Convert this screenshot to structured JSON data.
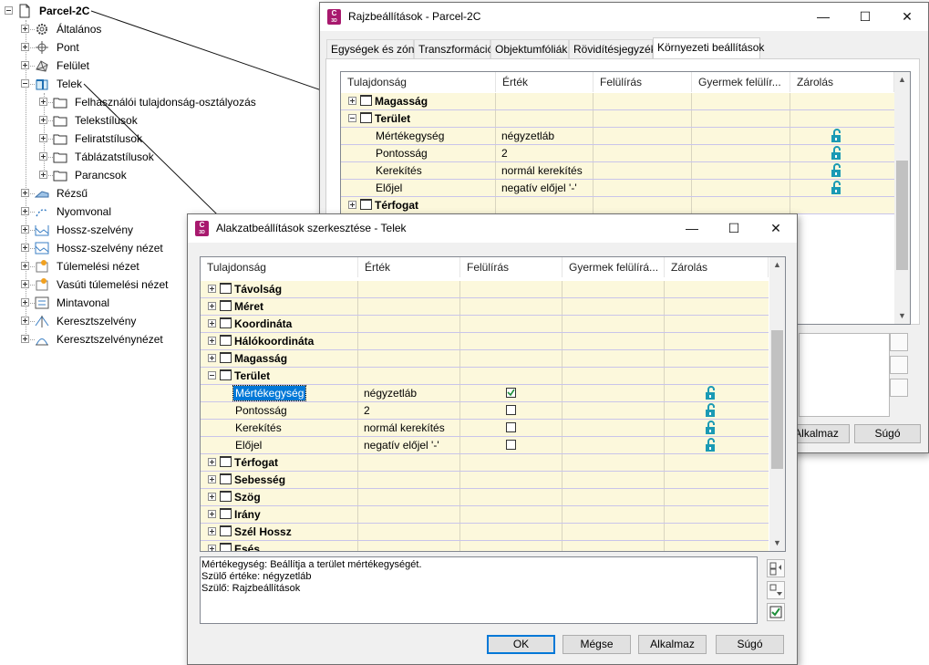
{
  "tree": {
    "root": {
      "label": "Parcel-2C",
      "icon": "drawing-page-icon"
    },
    "items": [
      {
        "label": "Általános",
        "icon": "gear-icon"
      },
      {
        "label": "Pont",
        "icon": "point-icon"
      },
      {
        "label": "Felület",
        "icon": "surface-icon"
      },
      {
        "label": "Telek",
        "icon": "parcel-icon"
      },
      {
        "label": "Felhasználói tulajdonság-osztályozás",
        "icon": "folder-icon"
      },
      {
        "label": "Telekstílusok",
        "icon": "folder-icon"
      },
      {
        "label": "Feliratstílusok",
        "icon": "folder-icon"
      },
      {
        "label": "Táblázatstílusok",
        "icon": "folder-icon"
      },
      {
        "label": "Parancsok",
        "icon": "folder-icon"
      },
      {
        "label": "Rézsű",
        "icon": "grading-icon"
      },
      {
        "label": "Nyomvonal",
        "icon": "alignment-icon"
      },
      {
        "label": "Hossz-szelvény",
        "icon": "profile-icon"
      },
      {
        "label": "Hossz-szelvény nézet",
        "icon": "profile-view-icon"
      },
      {
        "label": "Túlemelési nézet",
        "icon": "superelevation-view-icon"
      },
      {
        "label": "Vasúti túlemelési nézet",
        "icon": "rail-superelevation-icon"
      },
      {
        "label": "Mintavonal",
        "icon": "sample-line-icon"
      },
      {
        "label": "Keresztszelvény",
        "icon": "section-icon"
      },
      {
        "label": "Keresztszelvénynézet",
        "icon": "section-view-icon"
      }
    ]
  },
  "drawing_settings": {
    "title": "Rajzbeállítások - Parcel-2C",
    "tabs": [
      "Egységek és zóna",
      "Transzformáció",
      "Objektumfóliák",
      "Rövidítésjegyzék",
      "Környezeti beállítások"
    ],
    "active_tab": "Környezeti beállítások",
    "columns": [
      "Tulajdonság",
      "Érték",
      "Felülírás",
      "Gyermek felülír...",
      "Zárolás"
    ],
    "rows": [
      {
        "name": "Magasság",
        "value": "",
        "group": true,
        "expanded": false
      },
      {
        "name": "Terület",
        "value": "",
        "group": true,
        "expanded": true
      },
      {
        "name": "Mértékegység",
        "value": "négyzetláb",
        "group": false,
        "lock": true
      },
      {
        "name": "Pontosság",
        "value": "2",
        "group": false,
        "lock": true
      },
      {
        "name": "Kerekítés",
        "value": "normál kerekítés",
        "group": false,
        "lock": true
      },
      {
        "name": "Előjel",
        "value": "negatív előjel '-'",
        "group": false,
        "lock": true
      },
      {
        "name": "Térfogat",
        "value": "",
        "group": true,
        "expanded": false
      }
    ],
    "buttons": {
      "apply": "Alkalmaz",
      "help": "Súgó"
    }
  },
  "feature_settings": {
    "title": "Alakzatbeállítások szerkesztése - Telek",
    "columns": [
      "Tulajdonság",
      "Érték",
      "Felülírás",
      "Gyermek felülírá...",
      "Zárolás"
    ],
    "rows": [
      {
        "name": "Távolság",
        "value": "",
        "group": true,
        "expanded": false
      },
      {
        "name": "Méret",
        "value": "",
        "group": true,
        "expanded": false
      },
      {
        "name": "Koordináta",
        "value": "",
        "group": true,
        "expanded": false
      },
      {
        "name": "Hálókoordináta",
        "value": "",
        "group": true,
        "expanded": false
      },
      {
        "name": "Magasság",
        "value": "",
        "group": true,
        "expanded": false
      },
      {
        "name": "Terület",
        "value": "",
        "group": true,
        "expanded": true
      },
      {
        "name": "Mértékegység",
        "value": "négyzetláb",
        "group": false,
        "override": true,
        "lock": true,
        "selected": true
      },
      {
        "name": "Pontosság",
        "value": "2",
        "group": false,
        "override": false,
        "lock": true
      },
      {
        "name": "Kerekítés",
        "value": "normál kerekítés",
        "group": false,
        "override": false,
        "lock": true
      },
      {
        "name": "Előjel",
        "value": "negatív előjel '-'",
        "group": false,
        "override": false,
        "lock": true
      },
      {
        "name": "Térfogat",
        "value": "",
        "group": true,
        "expanded": false
      },
      {
        "name": "Sebesség",
        "value": "",
        "group": true,
        "expanded": false
      },
      {
        "name": "Szög",
        "value": "",
        "group": true,
        "expanded": false
      },
      {
        "name": "Irány",
        "value": "",
        "group": true,
        "expanded": false
      },
      {
        "name": "Szél Hossz",
        "value": "",
        "group": true,
        "expanded": false
      },
      {
        "name": "Esés",
        "value": "",
        "group": true,
        "expanded": false
      }
    ],
    "description": {
      "line1": "Mértékegység: Beállítja a terület mértékegységét.",
      "line2": "Szülő értéke: négyzetláb",
      "line3": "Szülő: Rajzbeállítások"
    },
    "buttons": {
      "ok": "OK",
      "cancel": "Mégse",
      "apply": "Alkalmaz",
      "help": "Súgó"
    }
  },
  "window_controls": {
    "minimize": "—",
    "maximize": "☐",
    "close": "✕"
  },
  "colors": {
    "row_bg": "#fcf8dc",
    "row_line": "#c9c5ea",
    "lock": "#1a9ab4",
    "app_icon": "#a8196e",
    "selection": "#0078d7"
  }
}
